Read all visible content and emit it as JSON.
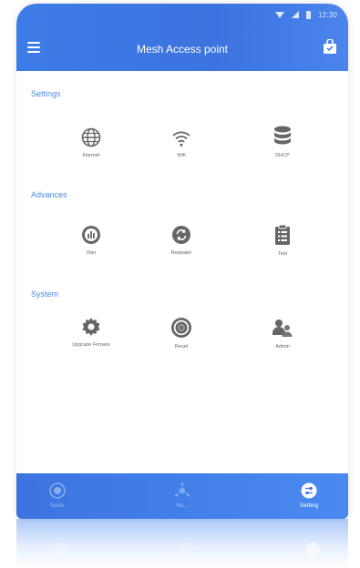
{
  "status_bar": {
    "time": "12:30"
  },
  "app_bar": {
    "title": "Mesh Access point"
  },
  "sections": [
    {
      "title": "Settings",
      "items": [
        {
          "label": "Internet",
          "icon": "globe-icon"
        },
        {
          "label": "Wifi",
          "icon": "wifi-icon"
        },
        {
          "label": "DHCP",
          "icon": "database-icon"
        }
      ]
    },
    {
      "title": "Advances",
      "items": [
        {
          "label": "Vlan",
          "icon": "chart-icon"
        },
        {
          "label": "Repeater",
          "icon": "repeat-icon"
        },
        {
          "label": "Test",
          "icon": "clipboard-icon"
        }
      ]
    },
    {
      "title": "System",
      "items": [
        {
          "label": "Upgrade Firmare",
          "icon": "gear-icon"
        },
        {
          "label": "Reset",
          "icon": "reset-icon"
        },
        {
          "label": "Admin",
          "icon": "users-icon"
        }
      ]
    }
  ],
  "tab_bar": {
    "tabs": [
      {
        "label": "Node",
        "icon": "node-icon",
        "active": false
      },
      {
        "label": "Ne...",
        "icon": "network-icon",
        "active": false
      },
      {
        "label": "Setting",
        "icon": "setting-icon",
        "active": true
      }
    ]
  },
  "colors": {
    "primary": "#3c73e0",
    "section_title": "#4a8ae8",
    "icon": "#666666"
  }
}
